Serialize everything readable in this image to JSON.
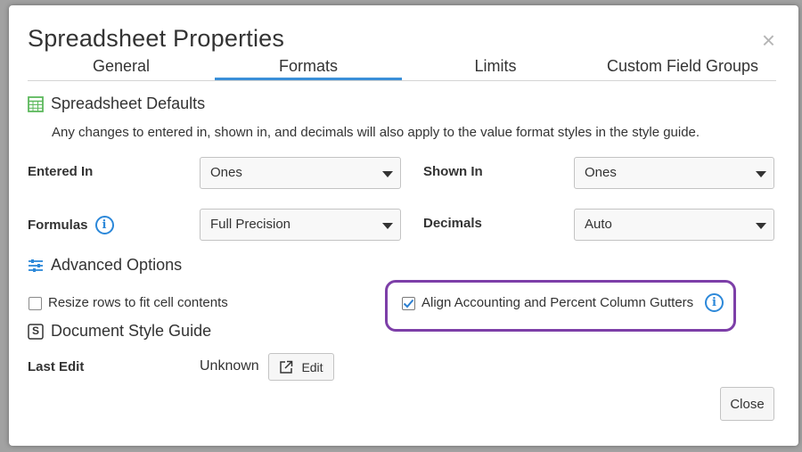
{
  "dialog": {
    "title": "Spreadsheet Properties",
    "close_glyph": "×"
  },
  "tabs": [
    {
      "label": "General",
      "active": false
    },
    {
      "label": "Formats",
      "active": true
    },
    {
      "label": "Limits",
      "active": false
    },
    {
      "label": "Custom Field Groups",
      "active": false
    }
  ],
  "defaults": {
    "heading": "Spreadsheet Defaults",
    "description": "Any changes to entered in, shown in, and decimals will also apply to the value format styles in the style guide.",
    "entered_in": {
      "label": "Entered In",
      "value": "Ones"
    },
    "shown_in": {
      "label": "Shown In",
      "value": "Ones"
    },
    "formulas": {
      "label": "Formulas",
      "value": "Full Precision"
    },
    "decimals": {
      "label": "Decimals",
      "value": "Auto"
    }
  },
  "advanced": {
    "heading": "Advanced Options",
    "resize_rows": {
      "label": "Resize rows to fit cell contents",
      "checked": false
    },
    "align_gutters": {
      "label": "Align Accounting and Percent Column Gutters",
      "checked": true
    }
  },
  "style_guide": {
    "heading": "Document Style Guide",
    "icon_letter": "S",
    "last_edit_label": "Last Edit",
    "last_edit_value": "Unknown",
    "edit_button": "Edit"
  },
  "footer": {
    "close_button": "Close"
  },
  "colors": {
    "accent": "#3a8fd8",
    "highlight": "#7d3fa8",
    "grid_icon": "#5cb85c",
    "info": "#2c88d9"
  },
  "icons": [
    "spreadsheet-grid-icon",
    "info-icon",
    "sliders-icon",
    "style-guide-icon",
    "external-link-icon",
    "checkmark-icon",
    "close-icon"
  ]
}
